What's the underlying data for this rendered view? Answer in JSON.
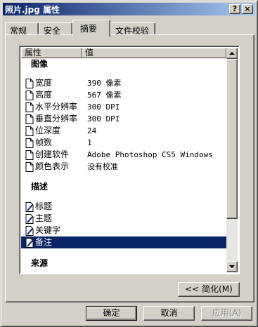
{
  "window": {
    "title": "照片.jpg 属性",
    "help_label": "?",
    "close_label": "×"
  },
  "tabs": [
    {
      "label": "常规"
    },
    {
      "label": "安全"
    },
    {
      "label": "摘要"
    },
    {
      "label": "文件校验"
    }
  ],
  "list": {
    "columns": {
      "property": "属性",
      "value": "值"
    },
    "groups": {
      "image": "图像",
      "description": "描述",
      "source": "来源"
    },
    "image_rows": [
      {
        "name": "宽度",
        "value": "390 像素"
      },
      {
        "name": "高度",
        "value": "567 像素"
      },
      {
        "name": "水平分辨率",
        "value": "300 DPI"
      },
      {
        "name": "垂直分辨率",
        "value": "300 DPI"
      },
      {
        "name": "位深度",
        "value": "24"
      },
      {
        "name": "帧数",
        "value": "1"
      },
      {
        "name": "创建软件",
        "value": "Adobe Photoshop CS5 Windows"
      },
      {
        "name": "颜色表示",
        "value": "没有校准"
      }
    ],
    "description_rows": [
      {
        "name": "标题",
        "value": ""
      },
      {
        "name": "主题",
        "value": ""
      },
      {
        "name": "关键字",
        "value": ""
      },
      {
        "name": "备注",
        "value": ""
      }
    ]
  },
  "buttons": {
    "simplify": "<< 简化(M)",
    "ok": "确定",
    "cancel": "取消",
    "apply": "应用(A)"
  },
  "icons": {
    "document": "document-icon",
    "editable": "pencil-document-icon"
  }
}
